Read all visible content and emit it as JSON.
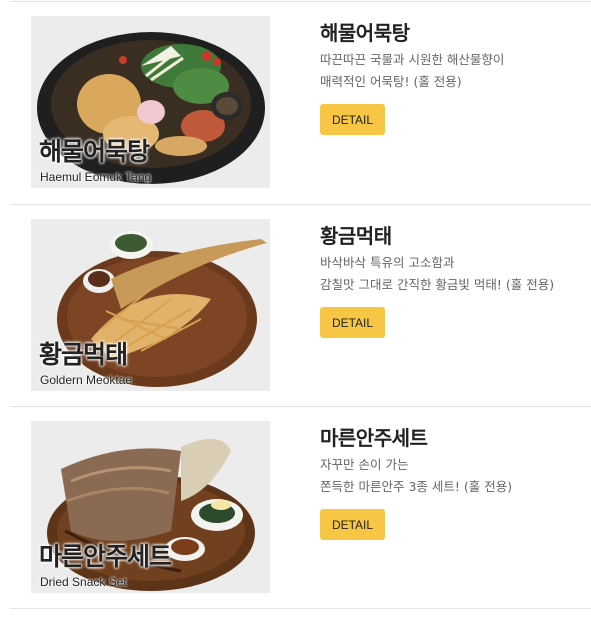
{
  "menu_items": [
    {
      "title": "해물어묵탕",
      "desc_line1": "따끈따끈 국물과 시원한 해산물향이",
      "desc_line2": "매력적인 어묵탕! (홀 전용)",
      "image_label_kor": "해물어묵탕",
      "image_label_eng": "Haemul Eomuk Tang",
      "button_label": "DETAIL"
    },
    {
      "title": "황금먹태",
      "desc_line1": "바삭바삭 특유의 고소함과",
      "desc_line2": "감칠맛 그대로 간직한 황금빛 먹태! (홀 전용)",
      "image_label_kor": "황금먹태",
      "image_label_eng": "Goldern Meoktae",
      "button_label": "DETAIL"
    },
    {
      "title": "마른안주세트",
      "desc_line1": "자꾸만 손이 가는",
      "desc_line2": "쫀득한 마른안주 3종 세트! (홀 전용)",
      "image_label_kor": "마른안주세트",
      "image_label_eng": "Dried Snack Set",
      "button_label": "DETAIL"
    }
  ],
  "colors": {
    "button_bg": "#f7c645",
    "divider": "#e4e4e4",
    "title_text": "#222222",
    "desc_text": "#666666",
    "thumb_bg": "#ebebeb"
  }
}
